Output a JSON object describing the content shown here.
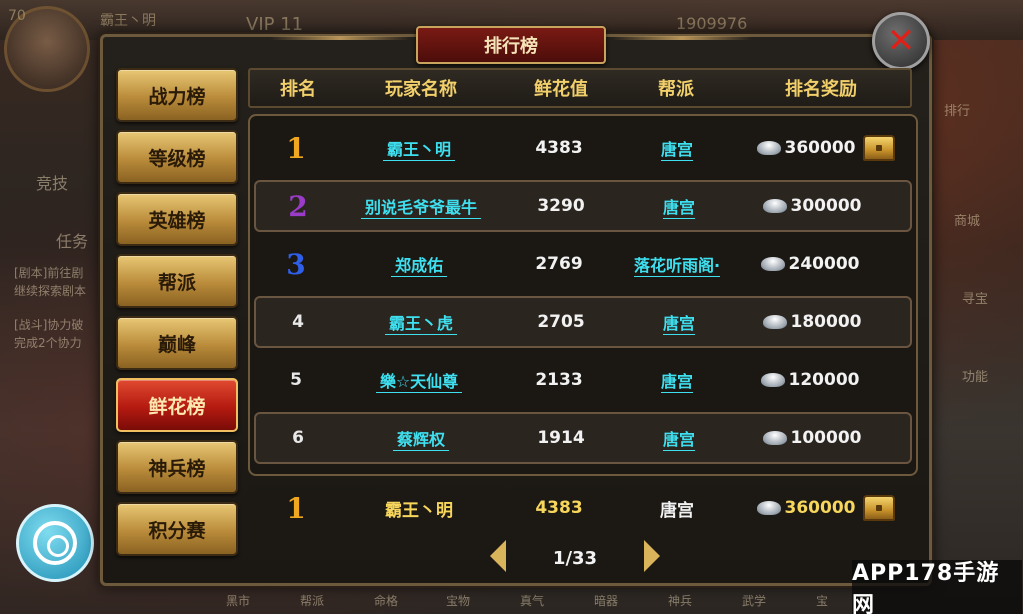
{
  "panel": {
    "title": "排行榜"
  },
  "categories": [
    {
      "label": "战力榜",
      "active": false
    },
    {
      "label": "等级榜",
      "active": false
    },
    {
      "label": "英雄榜",
      "active": false
    },
    {
      "label": "帮派",
      "active": false
    },
    {
      "label": "巅峰",
      "active": false
    },
    {
      "label": "鲜花榜",
      "active": true
    },
    {
      "label": "神兵榜",
      "active": false
    },
    {
      "label": "积分赛",
      "active": false
    }
  ],
  "columns": {
    "rank": "排名",
    "player": "玩家名称",
    "flowers": "鲜花值",
    "guild": "帮派",
    "reward": "排名奖励"
  },
  "rows": [
    {
      "rank": "1",
      "player": "霸王丶明",
      "flowers": "4383",
      "guild": "唐宫",
      "reward": "360000",
      "chest": true
    },
    {
      "rank": "2",
      "player": "别说毛爷爷最牛",
      "flowers": "3290",
      "guild": "唐宫",
      "reward": "300000",
      "chest": false
    },
    {
      "rank": "3",
      "player": "郑成佑",
      "flowers": "2769",
      "guild": "落花听雨阁·",
      "reward": "240000",
      "chest": false
    },
    {
      "rank": "4",
      "player": "霸王丶虎",
      "flowers": "2705",
      "guild": "唐宫",
      "reward": "180000",
      "chest": false
    },
    {
      "rank": "5",
      "player": "樂☆天仙尊",
      "flowers": "2133",
      "guild": "唐宫",
      "reward": "120000",
      "chest": false
    },
    {
      "rank": "6",
      "player": "蔡辉权",
      "flowers": "1914",
      "guild": "唐宫",
      "reward": "100000",
      "chest": false
    }
  ],
  "my_rank": {
    "rank": "1",
    "player": "霸王丶明",
    "flowers": "4383",
    "guild": "唐宫",
    "reward": "360000"
  },
  "pager": {
    "label": "1/33"
  },
  "background": {
    "top_name": "霸王丶明",
    "vip": "VIP 11",
    "gold": "1909976",
    "level": "70",
    "left_labels": [
      "竞技",
      "任务"
    ],
    "quest_lines": [
      "[剧本]前往剧",
      "继续探索剧本",
      "[战斗]协力破",
      "完成2个协力"
    ],
    "right_labels": [
      "排行",
      "商城",
      "寻宝",
      "功能"
    ],
    "bottom_labels": [
      "黑市",
      "帮派",
      "命格",
      "宝物",
      "真气",
      "暗器",
      "神兵",
      "武学",
      "宝"
    ]
  },
  "watermark": "APP178手游网",
  "colors": {
    "gold_text": "#f1cf6a",
    "link": "#3ee0f0",
    "active_tab": "#b41a10",
    "rank1": "#f0a820",
    "rank2": "#9a3cc8",
    "rank3": "#2f5fe8"
  }
}
